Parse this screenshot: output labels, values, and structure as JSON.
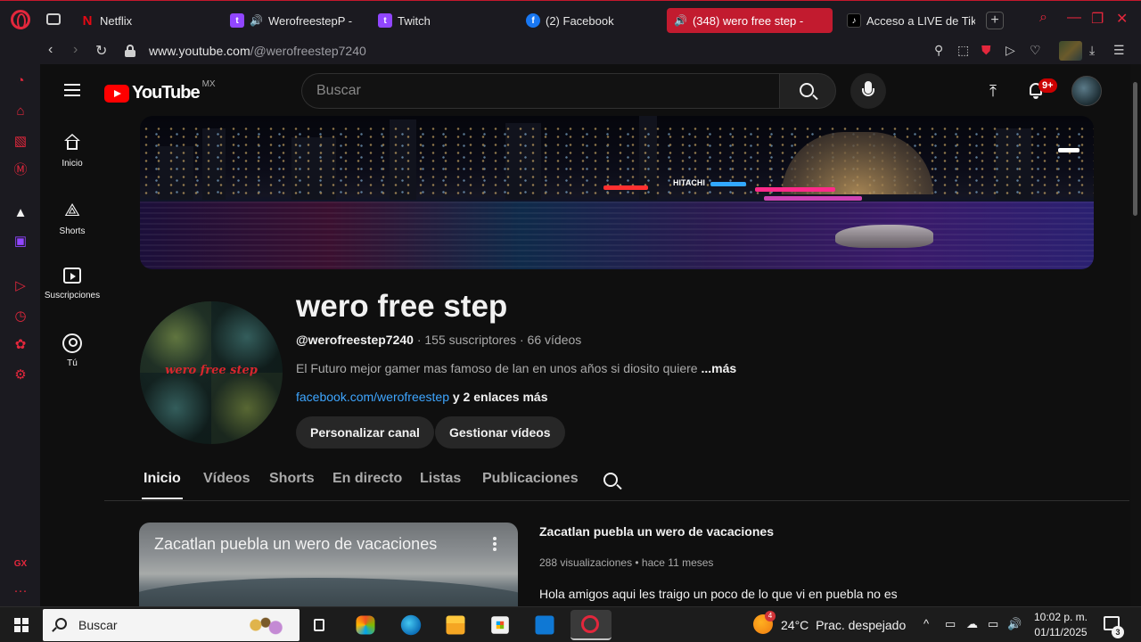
{
  "browser": {
    "tabs": [
      {
        "label": "Netflix",
        "icon": "netflix-icon"
      },
      {
        "label": "WerofreestepP -",
        "icon": "twitch-icon"
      },
      {
        "label": "Twitch",
        "icon": "twitch-icon"
      },
      {
        "label": "(2) Facebook",
        "icon": "facebook-icon"
      },
      {
        "label": "(348) wero free step -",
        "icon": "youtube-icon"
      },
      {
        "label": "Acceso a LIVE de Tik",
        "icon": "tiktok-icon"
      }
    ],
    "url_host": "www.youtube.com",
    "url_path": "/@werofreestep7240",
    "accent": "#e3273c"
  },
  "sidebar_opera": {
    "label_gx": "GX",
    "more": "···"
  },
  "youtube": {
    "logo_text": "YouTube",
    "country_code": "MX",
    "search_placeholder": "Buscar",
    "notif_count": "9+",
    "nav": [
      {
        "label": "Inicio"
      },
      {
        "label": "Shorts"
      },
      {
        "label": "Suscripciones"
      },
      {
        "label": "Tú"
      }
    ],
    "banner_signs": [
      "HITACHI"
    ],
    "channel": {
      "name": "wero free step",
      "handle": "@werofreestep7240",
      "meta": " · 155 suscriptores · 66 vídeos",
      "description": "El Futuro mejor  gamer mas famoso de lan en unos años si diosito quiere ",
      "more": "...más",
      "link": "facebook.com/werofreestep",
      "link_extra": " y 2 enlaces más",
      "avatar_text": "wero free step",
      "buttons": {
        "customize": "Personalizar canal",
        "manage": "Gestionar vídeos"
      }
    },
    "tabs": [
      "Inicio",
      "Vídeos",
      "Shorts",
      "En directo",
      "Listas",
      "Publicaciones"
    ],
    "active_tab": "Inicio",
    "featured": {
      "thumb_title": "Zacatlan puebla un wero de vacaciones",
      "title": "Zacatlan puebla un wero de vacaciones",
      "stats": "288 visualizaciones • hace 11 meses",
      "description": "Hola amigos aqui les traigo un poco de lo que vi en puebla no es"
    }
  },
  "taskbar": {
    "search_label": "Buscar",
    "weather_temp": "24°C",
    "weather_desc": "Prac. despejado",
    "weather_badge": "4",
    "time": "10:02 p. m.",
    "date": "01/11/2025",
    "notif_count": "3"
  }
}
